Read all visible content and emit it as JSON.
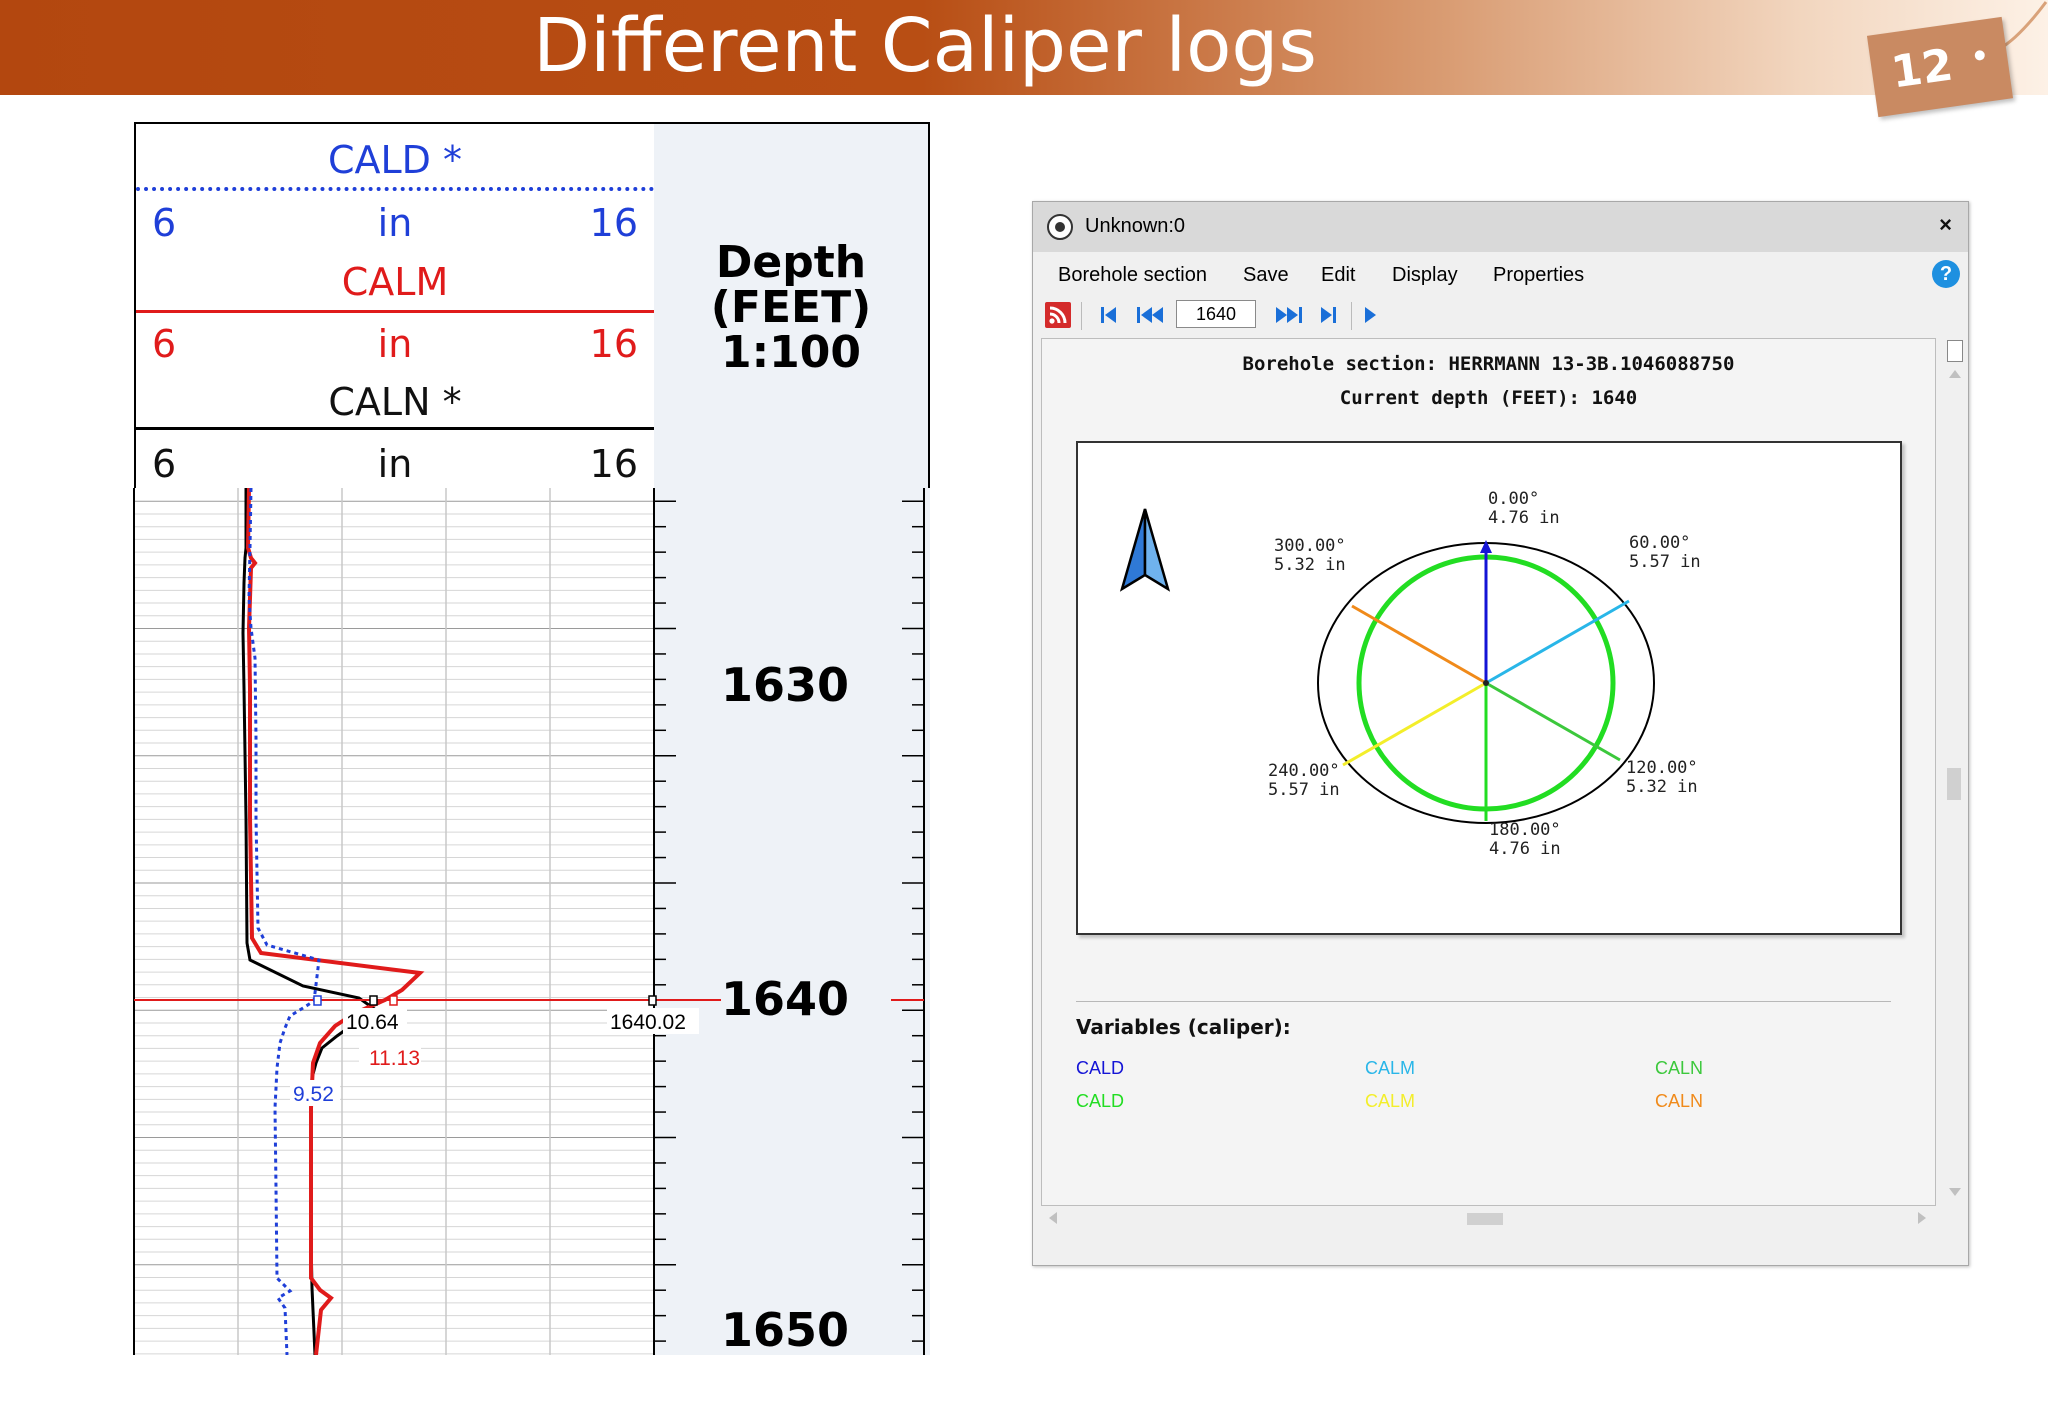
{
  "slide": {
    "title": "Different Caliper logs",
    "page_number": "12",
    "banner_color": "#b3470f"
  },
  "log_header": {
    "tracks": [
      {
        "name": "CALD *",
        "color": "#1f3fd8",
        "min": "6",
        "unit": "in",
        "max": "16",
        "line_style": "dotted"
      },
      {
        "name": "CALM",
        "color": "#e01b1b",
        "min": "6",
        "unit": "in",
        "max": "16",
        "line_style": "solid"
      },
      {
        "name": "CALN *",
        "color": "#000000",
        "min": "6",
        "unit": "in",
        "max": "16",
        "line_style": "solid"
      }
    ],
    "depth_title": "Depth\n(FEET)\n1:100"
  },
  "log_body": {
    "depth_labels": [
      "1630",
      "1640",
      "1650"
    ],
    "readouts": [
      {
        "text": "10.64",
        "color": "#000000"
      },
      {
        "text": "11.13",
        "color": "#e01b1b"
      },
      {
        "text": "9.52",
        "color": "#1f3fd8"
      },
      {
        "text": "1640.02",
        "color": "#000000"
      }
    ]
  },
  "viewer": {
    "window_title": "Unknown:0",
    "close_label": "×",
    "menu": [
      "Borehole section",
      "Save",
      "Edit",
      "Display",
      "Properties"
    ],
    "help_label": "?",
    "depth_value": "1640",
    "section_title": "Borehole section: HERRMANN 13-3B.1046088750",
    "current_depth": "Current depth (FEET): 1640",
    "arms": [
      {
        "angle": "0.00°",
        "radius": "4.76 in",
        "color": "#1414d6"
      },
      {
        "angle": "60.00°",
        "radius": "5.57 in",
        "color": "#29b6e8"
      },
      {
        "angle": "120.00°",
        "radius": "5.32 in",
        "color": "#3cc83c"
      },
      {
        "angle": "180.00°",
        "radius": "4.76 in",
        "color": "#22dd22"
      },
      {
        "angle": "240.00°",
        "radius": "5.57 in",
        "color": "#f3ee2a"
      },
      {
        "angle": "300.00°",
        "radius": "5.32 in",
        "color": "#f08a1a"
      }
    ],
    "variables_title": "Variables (caliper):",
    "variables": [
      {
        "label": "CALD",
        "color": "#1414d6"
      },
      {
        "label": "CALM",
        "color": "#29b6e8"
      },
      {
        "label": "CALN",
        "color": "#3cc83c"
      },
      {
        "label": "CALD",
        "color": "#22dd22"
      },
      {
        "label": "CALM",
        "color": "#f3ee2a"
      },
      {
        "label": "CALN",
        "color": "#f08a1a"
      }
    ]
  }
}
